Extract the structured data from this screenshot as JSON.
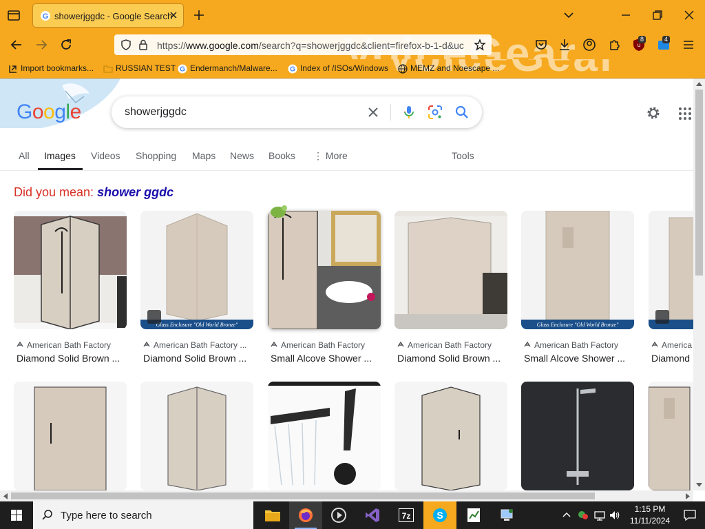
{
  "browser": {
    "tab_title": "showerjggdc - Google Search",
    "url_prefix": "https://",
    "url_domain": "www.google.com",
    "url_rest": "/search?q=showerjggdc&client=firefox-b-1-d&uc",
    "theme_text": "VoiceGear",
    "badges": {
      "ublock": "8",
      "ext": "4"
    },
    "bookmarks": [
      {
        "label": "Import bookmarks...",
        "icon": "import-icon"
      },
      {
        "label": "RUSSIAN TEST",
        "icon": "folder-icon"
      },
      {
        "label": "Endermanch/Malware...",
        "icon": "google-g-icon"
      },
      {
        "label": "Index of /ISOs/Windows",
        "icon": "google-g-icon"
      },
      {
        "label": "MEMZ and Noescape ...",
        "icon": "globe-icon"
      }
    ]
  },
  "google": {
    "logo_letters": [
      "G",
      "o",
      "o",
      "g",
      "l",
      "e"
    ],
    "query": "showerjggdc",
    "tabs": [
      "All",
      "Images",
      "Videos",
      "Shopping",
      "Maps",
      "News",
      "Books",
      "More",
      "Tools"
    ],
    "active_tab": "Images",
    "did_you_mean_prefix": "Did you mean: ",
    "did_you_mean_suggestion": "shower ggdc"
  },
  "results_row1": [
    {
      "source": "American Bath Factory",
      "title": "Diamond Solid Brown ..."
    },
    {
      "source": "American Bath Factory ...",
      "title": "Diamond Solid Brown ..."
    },
    {
      "source": "American Bath Factory",
      "title": "Small Alcove Shower ..."
    },
    {
      "source": "American Bath Factory",
      "title": "Diamond Solid Brown ..."
    },
    {
      "source": "American Bath Factory",
      "title": "Small Alcove Shower ..."
    },
    {
      "source": "America",
      "title": "Diamond"
    }
  ],
  "banner_text": "Glass Enclosure  \"Old World Bronze\"",
  "taskbar": {
    "search_placeholder": "Type here to search",
    "time": "1:15 PM",
    "date": "11/11/2024"
  },
  "colors": {
    "chrome_orange": "#f6a91e",
    "tab_active": "#fbcc52",
    "google_blue": "#4285f4",
    "google_red": "#ea4335",
    "google_yellow": "#fbbc05",
    "google_green": "#34a853",
    "dym_red": "#d93025",
    "suggestion_link": "#1a0dab"
  }
}
